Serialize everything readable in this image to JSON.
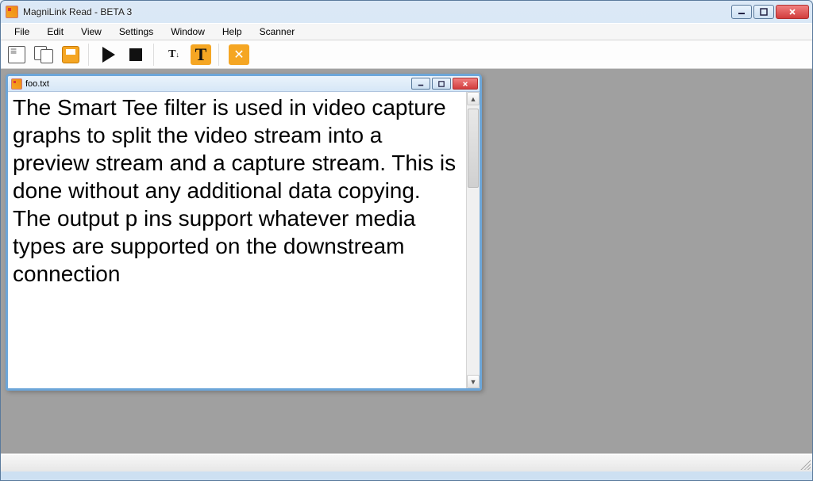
{
  "window": {
    "title": "MagniLink Read - BETA 3"
  },
  "menu": {
    "items": [
      "File",
      "Edit",
      "View",
      "Settings",
      "Window",
      "Help",
      "Scanner"
    ]
  },
  "toolbar": {
    "icons": {
      "new_doc": "new-doc-icon",
      "new_docs": "multi-doc-icon",
      "save": "save-icon",
      "play": "play-icon",
      "stop": "stop-icon",
      "text_small": "text-size-small-icon",
      "text_large": "text-size-large-icon",
      "tools": "tools-icon"
    }
  },
  "child_window": {
    "title": "foo.txt",
    "content": "The Smart Tee filter is used in video capture graphs to split the video stream into a preview stream and a capture stream. This is done without any additional data copying. The output p ins support whatever media types are supported on the downstream connection"
  }
}
